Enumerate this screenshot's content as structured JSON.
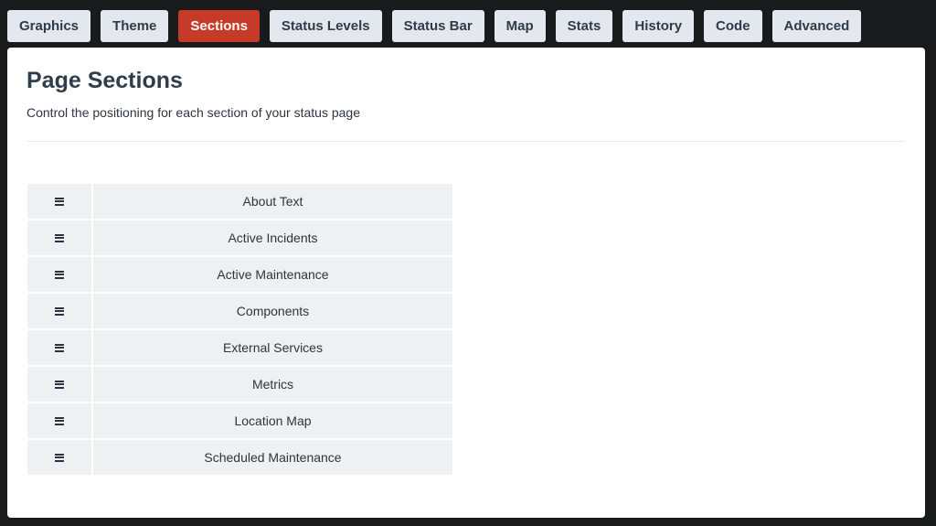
{
  "tabs": [
    {
      "label": "Graphics",
      "active": false
    },
    {
      "label": "Theme",
      "active": false
    },
    {
      "label": "Sections",
      "active": true
    },
    {
      "label": "Status Levels",
      "active": false
    },
    {
      "label": "Status Bar",
      "active": false
    },
    {
      "label": "Map",
      "active": false
    },
    {
      "label": "Stats",
      "active": false
    },
    {
      "label": "History",
      "active": false
    },
    {
      "label": "Code",
      "active": false
    },
    {
      "label": "Advanced",
      "active": false
    }
  ],
  "panel": {
    "title": "Page Sections",
    "subtitle": "Control the positioning for each section of your status page"
  },
  "sections": [
    {
      "label": "About Text",
      "icon": "drag-handle-icon"
    },
    {
      "label": "Active Incidents",
      "icon": "drag-handle-icon"
    },
    {
      "label": "Active Maintenance",
      "icon": "drag-handle-icon"
    },
    {
      "label": "Components",
      "icon": "drag-handle-icon"
    },
    {
      "label": "External Services",
      "icon": "drag-handle-icon"
    },
    {
      "label": "Metrics",
      "icon": "drag-handle-icon"
    },
    {
      "label": "Location Map",
      "icon": "drag-handle-icon"
    },
    {
      "label": "Scheduled Maintenance",
      "icon": "drag-handle-icon"
    }
  ],
  "colors": {
    "background": "#191a1c",
    "tab": "#e3e8ee",
    "tab_active": "#c63a28",
    "row": "#eef0f2",
    "title": "#2f3d4c"
  }
}
